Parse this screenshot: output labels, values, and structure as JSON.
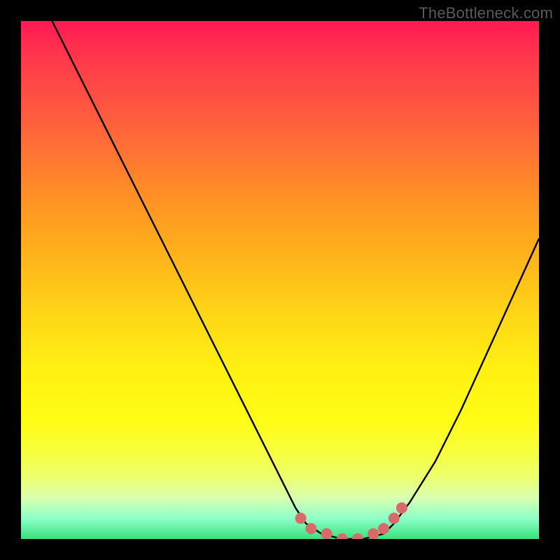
{
  "watermark": "TheBottleneck.com",
  "colors": {
    "frame": "#000000",
    "curve": "#000000",
    "marker": "#d96a6a",
    "gradient_top": "#ff1a54",
    "gradient_mid": "#ffe012",
    "gradient_bottom": "#38e27d"
  },
  "chart_data": {
    "type": "line",
    "title": "",
    "xlabel": "",
    "ylabel": "",
    "xlim": [
      0,
      100
    ],
    "ylim": [
      0,
      100
    ],
    "grid": false,
    "legend": false,
    "series": [
      {
        "name": "bottleneck-curve",
        "x": [
          6,
          10,
          15,
          20,
          25,
          30,
          35,
          40,
          45,
          50,
          53,
          55,
          58,
          62,
          66,
          70,
          72,
          75,
          80,
          85,
          90,
          95,
          100
        ],
        "y": [
          100,
          92,
          82,
          72,
          62,
          52,
          42,
          32,
          22,
          12,
          6,
          3,
          1,
          0,
          0,
          1,
          3,
          7,
          15,
          25,
          36,
          47,
          58
        ]
      }
    ],
    "markers": {
      "name": "highlight-dots",
      "points": [
        {
          "x": 54,
          "y": 4
        },
        {
          "x": 56,
          "y": 2
        },
        {
          "x": 59,
          "y": 1
        },
        {
          "x": 62,
          "y": 0
        },
        {
          "x": 65,
          "y": 0
        },
        {
          "x": 68,
          "y": 1
        },
        {
          "x": 70,
          "y": 2
        },
        {
          "x": 72,
          "y": 4
        },
        {
          "x": 73.5,
          "y": 6
        }
      ]
    }
  }
}
